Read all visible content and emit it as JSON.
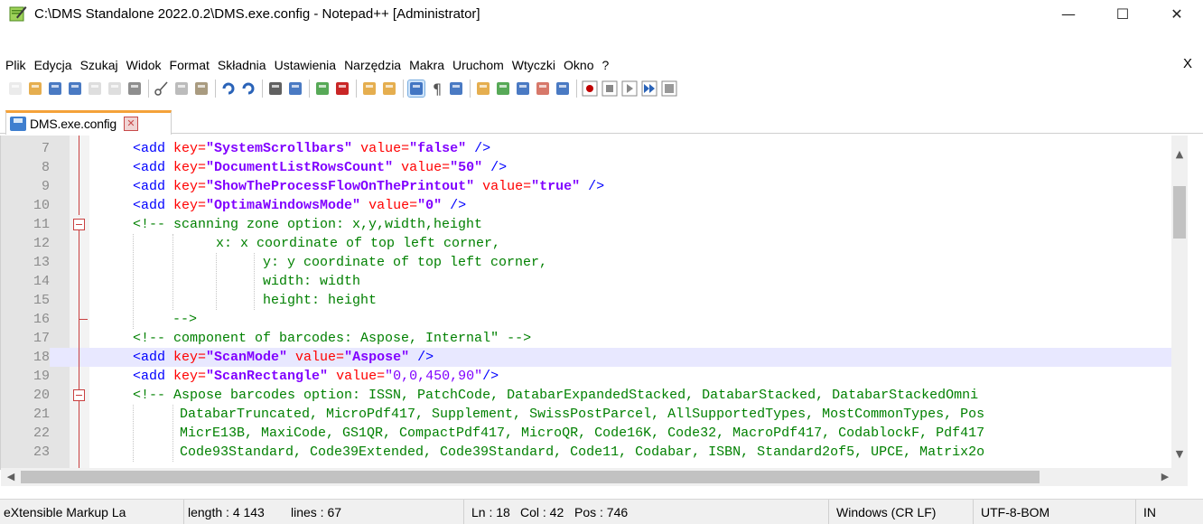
{
  "window": {
    "title": "C:\\DMS Standalone 2022.0.2\\DMS.exe.config - Notepad++ [Administrator]",
    "controls": {
      "minimize": "—",
      "maximize": "☐",
      "close": "✕"
    }
  },
  "menu": {
    "items": [
      "Plik",
      "Edycja",
      "Szukaj",
      "Widok",
      "Format",
      "Składnia",
      "Ustawienia",
      "Narzędzia",
      "Makra",
      "Uruchom",
      "Wtyczki",
      "Okno",
      "?"
    ],
    "close": "X"
  },
  "toolbar": {
    "icons": [
      "new-file-icon",
      "open-file-icon",
      "save-icon",
      "save-all-icon",
      "close-icon",
      "close-all-icon",
      "print-icon",
      "cut-icon",
      "copy-icon",
      "paste-icon",
      "undo-icon",
      "redo-icon",
      "find-icon",
      "replace-icon",
      "zoom-in-icon",
      "zoom-out-icon",
      "sync-vertical-icon",
      "sync-horizontal-icon",
      "word-wrap-icon",
      "show-all-chars-icon",
      "indent-guide-icon",
      "udl-icon",
      "doc-map-icon",
      "function-list-icon",
      "folder-workspace-icon",
      "monitor-icon",
      "record-macro-icon",
      "stop-macro-icon",
      "play-macro-icon",
      "run-macro-multiple-icon",
      "save-macro-icon"
    ],
    "colors": {
      "accent_red": "#c00000",
      "accent_blue": "#2a63b8",
      "accent_green": "#3a9a3a",
      "accent_orange": "#e0a030"
    }
  },
  "tab": {
    "label": "DMS.exe.config",
    "close": "✕"
  },
  "editor": {
    "current_line": 18,
    "lines": [
      {
        "n": "7",
        "indent": 1,
        "parts": [
          [
            "tag",
            "<add "
          ],
          [
            "attr",
            "key="
          ],
          [
            "val",
            "\"SystemScrollbars\""
          ],
          [
            "attr",
            " value="
          ],
          [
            "val",
            "\"false\""
          ],
          [
            "tag",
            " />"
          ]
        ]
      },
      {
        "n": "8",
        "indent": 1,
        "parts": [
          [
            "tag",
            "<add "
          ],
          [
            "attr",
            "key="
          ],
          [
            "val",
            "\"DocumentListRowsCount\""
          ],
          [
            "attr",
            " value="
          ],
          [
            "val",
            "\"50\""
          ],
          [
            "tag",
            " />"
          ]
        ]
      },
      {
        "n": "9",
        "indent": 1,
        "parts": [
          [
            "tag",
            "<add "
          ],
          [
            "attr",
            "key="
          ],
          [
            "val",
            "\"ShowTheProcessFlowOnThePrintout\""
          ],
          [
            "attr",
            " value="
          ],
          [
            "val",
            "\"true\""
          ],
          [
            "tag",
            " />"
          ]
        ]
      },
      {
        "n": "10",
        "indent": 1,
        "parts": [
          [
            "tag",
            "<add "
          ],
          [
            "attr",
            "key="
          ],
          [
            "val",
            "\"OptimaWindowsMode\""
          ],
          [
            "attr",
            " value="
          ],
          [
            "val",
            "\"0\""
          ],
          [
            "tag",
            " />"
          ]
        ]
      },
      {
        "n": "11",
        "indent": 1,
        "parts": [
          [
            "comment",
            "<!-- scanning zone option: x,y,width,height"
          ]
        ]
      },
      {
        "n": "12",
        "indent": 3,
        "parts": [
          [
            "comment",
            "x: x coordinate of top left corner,"
          ]
        ]
      },
      {
        "n": "13",
        "indent": 4,
        "parts": [
          [
            "comment",
            "y: y coordinate of top left corner,"
          ]
        ]
      },
      {
        "n": "14",
        "indent": 4,
        "parts": [
          [
            "comment",
            "width: width"
          ]
        ]
      },
      {
        "n": "15",
        "indent": 4,
        "parts": [
          [
            "comment",
            "height: height"
          ]
        ]
      },
      {
        "n": "16",
        "indent": 2,
        "parts": [
          [
            "comment",
            "-->"
          ]
        ]
      },
      {
        "n": "17",
        "indent": 1,
        "parts": [
          [
            "comment",
            "<!-- component of barcodes: Aspose, Internal\" -->"
          ]
        ]
      },
      {
        "n": "18",
        "indent": 1,
        "parts": [
          [
            "tag",
            "<add "
          ],
          [
            "attr",
            "key="
          ],
          [
            "val",
            "\"ScanMode\""
          ],
          [
            "attr",
            " value="
          ],
          [
            "val",
            "\"Aspose\""
          ],
          [
            "tag",
            " />"
          ]
        ]
      },
      {
        "n": "19",
        "indent": 1,
        "parts": [
          [
            "tag",
            "<add "
          ],
          [
            "attr",
            "key="
          ],
          [
            "val",
            "\"ScanRectangle\""
          ],
          [
            "attr",
            " value="
          ],
          [
            "val2",
            "\"0,0,450,90\""
          ],
          [
            "tag",
            "/>"
          ]
        ]
      },
      {
        "n": "20",
        "indent": 1,
        "parts": [
          [
            "comment",
            "<!-- Aspose barcodes option: ISSN, PatchCode, DatabarExpandedStacked, DatabarStacked, DatabarStackedOmni"
          ]
        ]
      },
      {
        "n": "21",
        "indent": 5,
        "parts": [
          [
            "comment",
            "DatabarTruncated, MicroPdf417, Supplement, SwissPostParcel, AllSupportedTypes, MostCommonTypes, Pos"
          ]
        ]
      },
      {
        "n": "22",
        "indent": 5,
        "parts": [
          [
            "comment",
            "MicrE13B, MaxiCode, GS1QR, CompactPdf417, MicroQR, Code16K, Code32, MacroPdf417, CodablockF, Pdf417"
          ]
        ]
      },
      {
        "n": "23",
        "indent": 5,
        "parts": [
          [
            "comment",
            "Code93Standard, Code39Extended, Code39Standard, Code11, Codabar, ISBN, Standard2of5, UPCE, Matrix2o"
          ]
        ]
      }
    ]
  },
  "statusbar": {
    "language": "eXtensible Markup La",
    "length": "length : 4 143",
    "lines": "lines : 67",
    "ln": "Ln : 18",
    "col": "Col : 42",
    "pos": "Pos : 746",
    "eol": "Windows (CR LF)",
    "encoding": "UTF-8-BOM",
    "mode": "IN"
  }
}
